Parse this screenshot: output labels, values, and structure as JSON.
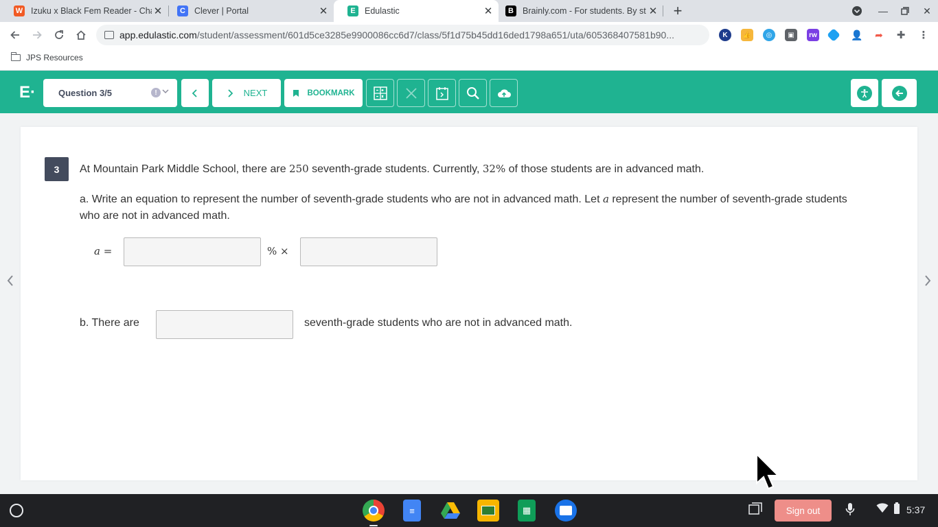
{
  "browser": {
    "tabs": [
      {
        "title": "Izuku x Black Fem Reader - Chap",
        "favicon": "W",
        "color": "#f15a24",
        "active": false
      },
      {
        "title": "Clever | Portal",
        "favicon": "C",
        "color": "#4274f6",
        "active": false
      },
      {
        "title": "Edulastic",
        "favicon": "E",
        "color": "#1fb391",
        "active": true
      },
      {
        "title": "Brainly.com - For students. By st",
        "favicon": "B",
        "color": "#000000",
        "active": false
      }
    ],
    "url_domain": "app.edulastic.com",
    "url_path": "/student/assessment/601d5ce3285e9900086cc6d7/class/5f1d75b45dd16ded1798a651/uta/605368407581b90...",
    "bookmark": "JPS Resources"
  },
  "app": {
    "logo": "E·",
    "question_selector": "Question 3/5",
    "next_label": "NEXT",
    "bookmark_label": "BOOKMARK",
    "accent": "#1fb391"
  },
  "question": {
    "number": "3",
    "stem_pre": "At Mountain Park Middle School, there are ",
    "stem_num": "250",
    "stem_mid": " seventh-grade students.  Currently, ",
    "stem_pct": "32%",
    "stem_post": " of those students are in advanced math.",
    "part_a_pre": "a.  Write an equation to represent the number of seventh-grade students who are not in advanced math.  Let ",
    "part_a_var": "a",
    "part_a_post": " represent the number of seventh-grade students who are not in advanced math.",
    "eq_lhs": "a =",
    "eq_op": "% ×",
    "part_b_pre": "b.  There are",
    "part_b_post": "seventh-grade students who are not in advanced math."
  },
  "shelf": {
    "signout": "Sign out",
    "time": "5:37"
  }
}
